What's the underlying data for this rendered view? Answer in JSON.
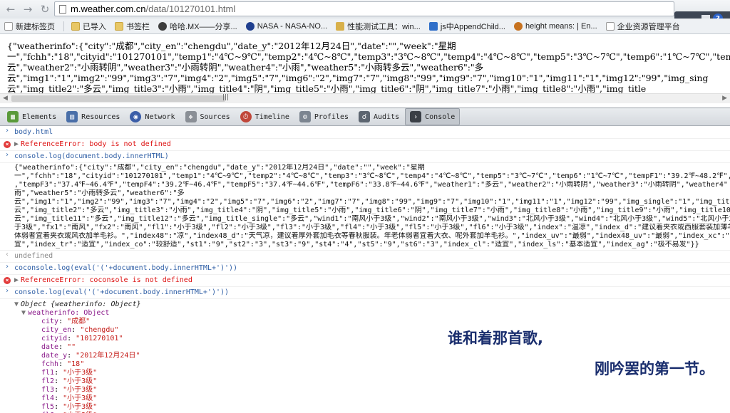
{
  "browser": {
    "url_host": "m.weather.com.cn",
    "url_path": "/data/101270101.html",
    "back_icon": "back-arrow-icon",
    "forward_icon": "forward-arrow-icon",
    "reload_icon": "reload-icon"
  },
  "bookmarks": [
    {
      "label": "新建标签页",
      "icon": "page-icon"
    },
    {
      "label": "已导入",
      "icon": "folder-icon"
    },
    {
      "label": "书签栏",
      "icon": "folder-icon"
    },
    {
      "label": "哈哈.MX——分享...",
      "icon": "site-icon"
    },
    {
      "label": "NASA - NASA-NO...",
      "icon": "nasa-icon"
    },
    {
      "label": "性能测试工具：win...",
      "icon": "site-icon"
    },
    {
      "label": "js中AppendChild...",
      "icon": "js-icon"
    },
    {
      "label": "height means: | En...",
      "icon": "site-icon"
    },
    {
      "label": "企业资源管理平台",
      "icon": "page-icon"
    }
  ],
  "page_content": {
    "lines": [
      "{\"weatherinfo\":{\"city\":\"成都\",\"city_en\":\"chengdu\",\"date_y\":\"2012年12月24日\",\"date\":\"\",\"week\":\"星期",
      "一\",\"fchh\":\"18\",\"cityid\":\"101270101\",\"temp1\":\"4℃~9℃\",\"temp2\":\"4℃~8℃\",\"temp3\":\"3℃~8℃\",\"temp4\":\"4℃~8℃\",\"temp5\":\"3℃~7℃\",\"temp6\":\"1℃~7℃\",\"temp",
      "云\",\"weather2\":\"小雨转阴\",\"weather3\":\"小雨转阴\",\"weather4\":\"小雨\",\"weather5\":\"小雨转多云\",\"weather6\":\"多",
      "云\",\"img1\":\"1\",\"img2\":\"99\",\"img3\":\"7\",\"img4\":\"2\",\"img5\":\"7\",\"img6\":\"2\",\"img7\":\"7\",\"img8\":\"99\",\"img9\":\"7\",\"img10\":\"1\",\"img11\":\"1\",\"img12\":\"99\",\"img_sing",
      "云\",\"img_title2\":\"多云\",\"img_title3\":\"小雨\",\"img_title4\":\"阴\",\"img_title5\":\"小雨\",\"img_title6\":\"阴\",\"img_title7\":\"小雨\",\"img_title8\":\"小雨\",\"img_title"
    ]
  },
  "devtools": {
    "tabs": [
      {
        "label": "Elements",
        "icon": "elements-icon",
        "color": "#5a9a3a"
      },
      {
        "label": "Resources",
        "icon": "resources-icon",
        "color": "#4a6fa8"
      },
      {
        "label": "Network",
        "icon": "network-icon",
        "color": "#3b5ea8"
      },
      {
        "label": "Sources",
        "icon": "sources-icon",
        "color": "#8a8f96"
      },
      {
        "label": "Timeline",
        "icon": "timeline-icon",
        "color": "#c0473a"
      },
      {
        "label": "Profiles",
        "icon": "profiles-icon",
        "color": "#7c8590"
      },
      {
        "label": "Audits",
        "icon": "audits-icon",
        "color": "#5c6570"
      },
      {
        "label": "Console",
        "icon": "console-icon",
        "color": "#3a3f46"
      }
    ],
    "active_tab": "Console"
  },
  "console": {
    "cmd1": "body.html",
    "err1": "ReferenceError: body is not defined",
    "cmd2": "console.log(document.body.innerHTML)",
    "out_lines": [
      "{\"weatherinfo\":{\"city\":\"成都\",\"city_en\":\"chengdu\",\"date_y\":\"2012年12月24日\",\"date\":\"\",\"week\":\"星期",
      "一\",\"fchh\":\"18\",\"cityid\":\"101270101\",\"temp1\":\"4℃~9℃\",\"temp2\":\"4℃~8℃\",\"temp3\":\"3℃~8℃\",\"temp4\":\"4℃~8℃\",\"temp5\":\"3℃~7℃\",\"temp6\":\"1℃~7℃\",\"tempF1\":\"39.2℉~48.2℉\",\"tem",
      ",\"tempF3\":\"37.4℉~46.4℉\",\"tempF4\":\"39.2℉~46.4℉\",\"tempF5\":\"37.4℉~44.6℉\",\"tempF6\":\"33.8℉~44.6℉\",\"weather1\":\"多云\",\"weather2\":\"小雨转阴\",\"weather3\":\"小雨转阴\",\"weather4\"",
      "雨\",\"weather5\":\"小雨转多云\",\"weather6\":\"多",
      "云\",\"img1\":\"1\",\"img2\":\"99\",\"img3\":\"7\",\"img4\":\"2\",\"img5\":\"7\",\"img6\":\"2\",\"img7\":\"7\",\"img8\":\"99\",\"img9\":\"7\",\"img10\":\"1\",\"img11\":\"1\",\"img12\":\"99\",\"img_single\":\"1\",\"img_title1",
      "云\",\"img_title2\":\"多云\",\"img_title3\":\"小雨\",\"img_title4\":\"阴\",\"img_title5\":\"小雨\",\"img_title6\":\"阴\",\"img_title7\":\"小雨\",\"img_title8\":\"小雨\",\"img_title9\":\"小雨\",\"img_title10\":",
      "云\",\"img_title11\":\"多云\",\"img_title12\":\"多云\",\"img_title_single\":\"多云\",\"wind1\":\"南风小于3级\",\"wind2\":\"南风小于3级\",\"wind3\":\"北风小于3级\",\"wind4\":\"北风小于3级\",\"wind5\":\"北风小于3",
      "于3级\",\"fx1\":\"南风\",\"fx2\":\"南风\",\"fl1\":\"小于3级\",\"fl2\":\"小于3级\",\"fl3\":\"小于3级\",\"fl4\":\"小于3级\",\"fl5\":\"小于3级\",\"fl6\":\"小于3级\",\"index\":\"温凉\",\"index_d\":\"建议着夹衣或西服套装加薄羊",
      "体弱者宜着夹衣或风衣加羊毛衫。\",\"index48\":\"凉\",\"index48_d\":\"天气凉，建议着厚外套加毛衣等春秋服装。年老体弱者宜着大衣、呢外套加羊毛衫。\",\"index_uv\":\"最弱\",\"index48_uv\":\"最弱\",\"index_xc\":\"",
      "宜\",\"index_tr\":\"适宜\",\"index_co\":\"较舒适\",\"st1\":\"9\",\"st2\":\"3\",\"st3\":\"9\",\"st4\":\"4\",\"st5\":\"9\",\"st6\":\"3\",\"index_cl\":\"适宜\",\"index_ls\":\"基本适宜\",\"index_ag\":\"极不易发\"}}"
    ],
    "undef": "undefined",
    "cmd3": "coconsole.log(eval('('+document.body.innerHTML+')'))",
    "err2": "ReferenceError: coconsole is not defined",
    "cmd4": "console.log(eval('('+document.body.innerHTML+')'))",
    "obj_title": "Object {weatherinfo: Object}",
    "weatherinfo_label": "weatherinfo: Object",
    "props": [
      {
        "key": "city",
        "value": "\"成都\""
      },
      {
        "key": "city_en",
        "value": "\"chengdu\""
      },
      {
        "key": "cityid",
        "value": "\"101270101\""
      },
      {
        "key": "date",
        "value": "\"\""
      },
      {
        "key": "date_y",
        "value": "\"2012年12月24日\""
      },
      {
        "key": "fchh",
        "value": "\"18\""
      },
      {
        "key": "fl1",
        "value": "\"小于3级\""
      },
      {
        "key": "fl2",
        "value": "\"小于3级\""
      },
      {
        "key": "fl3",
        "value": "\"小于3级\""
      },
      {
        "key": "fl4",
        "value": "\"小于3级\""
      },
      {
        "key": "fl5",
        "value": "\"小于3级\""
      },
      {
        "key": "fl6",
        "value": "\"小于3级\""
      },
      {
        "key": "fx1",
        "value": "\"南风\""
      }
    ]
  },
  "subtitles": {
    "line1": "谁和着那首歌,",
    "line2": "刚吟罢的第一节。"
  }
}
